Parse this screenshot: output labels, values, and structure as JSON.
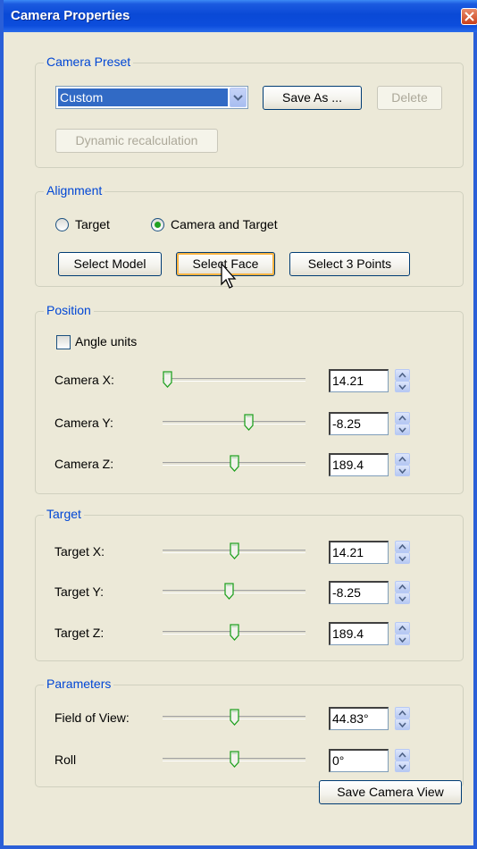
{
  "window": {
    "title": "Camera Properties"
  },
  "camera_preset": {
    "group_label": "Camera Preset",
    "preset_value": "Custom",
    "save_as_label": "Save As ...",
    "delete_label": "Delete",
    "dynamic_label": "Dynamic recalculation"
  },
  "alignment": {
    "group_label": "Alignment",
    "radio_target_label": "Target",
    "radio_camera_target_label": "Camera and Target",
    "selected_radio": "Camera and Target",
    "select_model_label": "Select Model",
    "select_face_label": "Select Face",
    "select_3points_label": "Select 3 Points"
  },
  "position": {
    "group_label": "Position",
    "angle_units_label": "Angle units",
    "angle_units_checked": false,
    "rows": [
      {
        "label": "Camera X:",
        "value": "14.21",
        "slider_fraction": 0.03
      },
      {
        "label": "Camera Y:",
        "value": "-8.25",
        "slider_fraction": 0.6
      },
      {
        "label": "Camera Z:",
        "value": "189.4",
        "slider_fraction": 0.5
      }
    ]
  },
  "target": {
    "group_label": "Target",
    "rows": [
      {
        "label": "Target X:",
        "value": "14.21",
        "slider_fraction": 0.5
      },
      {
        "label": "Target Y:",
        "value": "-8.25",
        "slider_fraction": 0.46
      },
      {
        "label": "Target Z:",
        "value": "189.4",
        "slider_fraction": 0.5
      }
    ]
  },
  "parameters": {
    "group_label": "Parameters",
    "rows": [
      {
        "label": "Field of View:",
        "value": "44.83°",
        "slider_fraction": 0.5
      },
      {
        "label": "Roll",
        "value": "0°",
        "slider_fraction": 0.5
      }
    ]
  },
  "footer": {
    "save_camera_view_label": "Save Camera View"
  },
  "colors": {
    "titlebar": "#0A49D6",
    "group_label": "#0046D5",
    "selection": "#316AC5"
  }
}
